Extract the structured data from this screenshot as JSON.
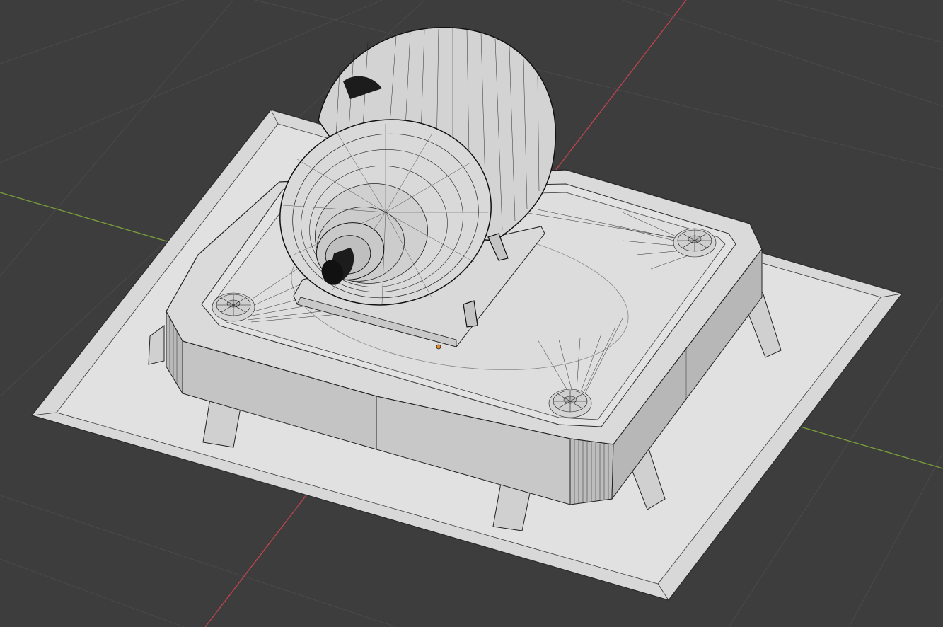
{
  "viewport": {
    "background_color": "#3d3d3d",
    "grid_color": "#4a4a4a",
    "axis_x_color": "#c0444f",
    "axis_y_color": "#7ba13a",
    "mesh_fill_color": "#dcdcdc",
    "mesh_shadow_color": "#c6c6c6",
    "wire_color": "#1a1a1a",
    "origin_color": "#e08a2a",
    "shading_mode": "wireframe-overlay",
    "icons": {
      "origin": "object-origin-icon"
    }
  }
}
